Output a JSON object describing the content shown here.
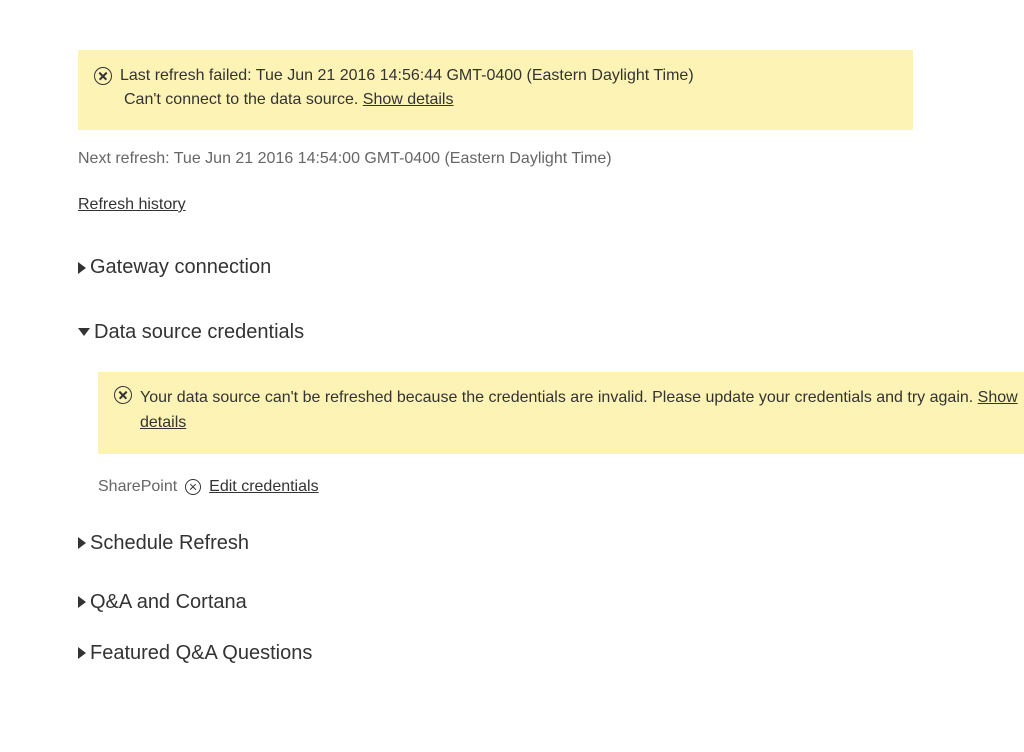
{
  "alert": {
    "line1": "Last refresh failed: Tue Jun 21 2016 14:56:44 GMT-0400 (Eastern Daylight Time)",
    "line2_a": "Can't connect to the data source. ",
    "show_details": "Show details"
  },
  "next_refresh": "Next refresh: Tue Jun 21 2016 14:54:00 GMT-0400 (Eastern Daylight Time)",
  "refresh_history": "Refresh history",
  "sections": {
    "gateway": "Gateway connection",
    "credentials": "Data source credentials",
    "schedule": "Schedule Refresh",
    "qa_cortana": "Q&A and Cortana",
    "featured_qa": "Featured Q&A Questions"
  },
  "cred_alert": {
    "text_a": "Your data source can't be refreshed because the credentials are invalid. Please update your credentials and try again. ",
    "show_details": "Show details"
  },
  "source": {
    "name": "SharePoint",
    "edit": "Edit credentials"
  }
}
